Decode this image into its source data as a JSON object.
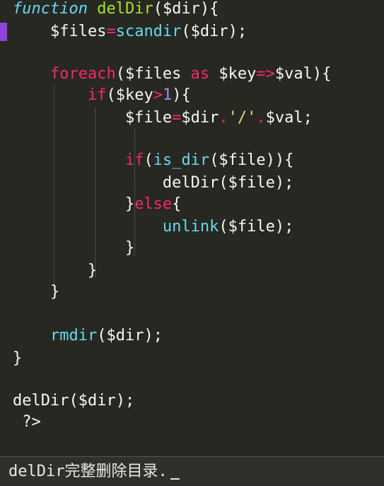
{
  "editor": {
    "lines": [
      {
        "tokens": [
          {
            "t": "function",
            "c": "kw"
          },
          {
            "t": " ",
            "c": "plain"
          },
          {
            "t": "delDir",
            "c": "fn"
          },
          {
            "t": "($dir){",
            "c": "plain"
          }
        ]
      },
      {
        "tokens": [
          {
            "t": "    $files",
            "c": "plain"
          },
          {
            "t": "=",
            "c": "op"
          },
          {
            "t": "scandir",
            "c": "call"
          },
          {
            "t": "($dir);",
            "c": "plain"
          }
        ]
      },
      {
        "tokens": []
      },
      {
        "tokens": [
          {
            "t": "    ",
            "c": "plain"
          },
          {
            "t": "foreach",
            "c": "ctl"
          },
          {
            "t": "($files ",
            "c": "plain"
          },
          {
            "t": "as",
            "c": "ctl"
          },
          {
            "t": " $key",
            "c": "plain"
          },
          {
            "t": "=>",
            "c": "op"
          },
          {
            "t": "$val){",
            "c": "plain"
          }
        ]
      },
      {
        "tokens": [
          {
            "t": "        ",
            "c": "plain"
          },
          {
            "t": "if",
            "c": "ctl"
          },
          {
            "t": "($key",
            "c": "plain"
          },
          {
            "t": ">",
            "c": "op"
          },
          {
            "t": "1",
            "c": "num"
          },
          {
            "t": "){",
            "c": "plain"
          }
        ]
      },
      {
        "tokens": [
          {
            "t": "            $file",
            "c": "plain"
          },
          {
            "t": "=",
            "c": "op"
          },
          {
            "t": "$dir",
            "c": "plain"
          },
          {
            "t": ".",
            "c": "op"
          },
          {
            "t": "'/'",
            "c": "str"
          },
          {
            "t": ".",
            "c": "op"
          },
          {
            "t": "$val;",
            "c": "plain"
          }
        ]
      },
      {
        "tokens": []
      },
      {
        "tokens": [
          {
            "t": "            ",
            "c": "plain"
          },
          {
            "t": "if",
            "c": "ctl"
          },
          {
            "t": "(",
            "c": "plain"
          },
          {
            "t": "is_dir",
            "c": "call"
          },
          {
            "t": "($file)){",
            "c": "plain"
          }
        ]
      },
      {
        "tokens": [
          {
            "t": "                delDir($file);",
            "c": "plain"
          }
        ]
      },
      {
        "tokens": [
          {
            "t": "            }",
            "c": "plain"
          },
          {
            "t": "else",
            "c": "ctl"
          },
          {
            "t": "{",
            "c": "plain"
          }
        ]
      },
      {
        "tokens": [
          {
            "t": "                ",
            "c": "plain"
          },
          {
            "t": "unlink",
            "c": "call"
          },
          {
            "t": "($file);",
            "c": "plain"
          }
        ]
      },
      {
        "tokens": [
          {
            "t": "            }",
            "c": "plain"
          }
        ]
      },
      {
        "tokens": [
          {
            "t": "        }",
            "c": "plain"
          }
        ]
      },
      {
        "tokens": [
          {
            "t": "    }",
            "c": "plain"
          }
        ]
      },
      {
        "tokens": []
      },
      {
        "tokens": [
          {
            "t": "    ",
            "c": "plain"
          },
          {
            "t": "rmdir",
            "c": "call"
          },
          {
            "t": "($dir);",
            "c": "plain"
          }
        ]
      },
      {
        "tokens": [
          {
            "t": "}",
            "c": "plain"
          }
        ]
      },
      {
        "tokens": []
      },
      {
        "tokens": [
          {
            "t": "delDir($dir);",
            "c": "plain"
          }
        ]
      },
      {
        "tokens": [
          {
            "t": " ?>",
            "c": "plain"
          }
        ]
      }
    ]
  },
  "status": {
    "caption": "delDir完整删除目录."
  },
  "colors": {
    "background": "#272822",
    "keyword": "#66d9ef",
    "function_name": "#a6e22e",
    "control": "#f92672",
    "string": "#e6db74",
    "number": "#ae81ff",
    "text": "#f8f8f2",
    "gutter_marker": "#8e44d8"
  }
}
